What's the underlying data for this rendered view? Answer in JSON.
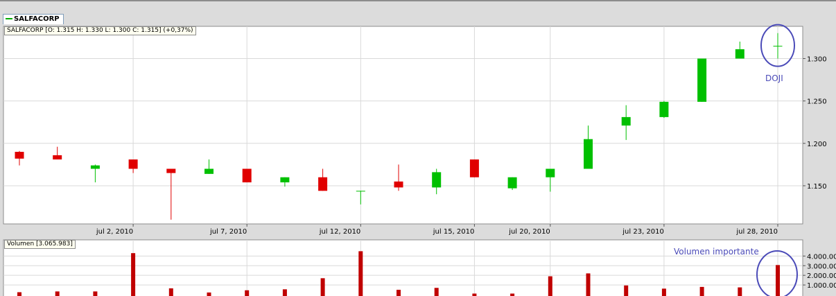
{
  "tab": {
    "label": "SALFACORP"
  },
  "price_info": "SALFACORP [O: 1.315  H: 1.330  L: 1.300  C: 1.315] (+0,37%)",
  "volume_info": "Volumen [3.065.983]",
  "annotations": {
    "doji": "DOJI",
    "volume": "Volumen importante"
  },
  "colors": {
    "up": "#00c000",
    "down": "#e00000",
    "volume": "#c00000",
    "annotation": "#4a4ab8",
    "grid": "#d9d9d9"
  },
  "chart_data": [
    {
      "type": "candlestick",
      "title": "",
      "x_tick_labels": [
        {
          "at": 3,
          "label": "jul 2, 2010"
        },
        {
          "at": 6,
          "label": "jul 7, 2010"
        },
        {
          "at": 9,
          "label": "jul 12, 2010"
        },
        {
          "at": 12,
          "label": "jul 15, 2010"
        },
        {
          "at": 14,
          "label": "jul 20, 2010"
        },
        {
          "at": 17,
          "label": "jul 23, 2010"
        },
        {
          "at": 20,
          "label": "jul 28, 2010"
        }
      ],
      "y_ticks": [
        1.15,
        1.2,
        1.25,
        1.3
      ],
      "y_tick_labels": [
        "1.150",
        "1.200",
        "1.250",
        "1.300"
      ],
      "ylim": [
        1.105,
        1.338
      ],
      "grid": true,
      "candles": [
        {
          "o": 1.19,
          "h": 1.191,
          "l": 1.174,
          "c": 1.182
        },
        {
          "o": 1.186,
          "h": 1.196,
          "l": 1.181,
          "c": 1.181
        },
        {
          "o": 1.17,
          "h": 1.175,
          "l": 1.154,
          "c": 1.174
        },
        {
          "o": 1.181,
          "h": 1.181,
          "l": 1.165,
          "c": 1.17
        },
        {
          "o": 1.17,
          "h": 1.17,
          "l": 1.11,
          "c": 1.165
        },
        {
          "o": 1.164,
          "h": 1.181,
          "l": 1.164,
          "c": 1.17
        },
        {
          "o": 1.17,
          "h": 1.17,
          "l": 1.154,
          "c": 1.154
        },
        {
          "o": 1.154,
          "h": 1.16,
          "l": 1.149,
          "c": 1.16
        },
        {
          "o": 1.16,
          "h": 1.17,
          "l": 1.144,
          "c": 1.144
        },
        {
          "o": 1.144,
          "h": 1.144,
          "l": 1.128,
          "c": 1.144
        },
        {
          "o": 1.155,
          "h": 1.175,
          "l": 1.144,
          "c": 1.148
        },
        {
          "o": 1.148,
          "h": 1.17,
          "l": 1.14,
          "c": 1.166
        },
        {
          "o": 1.181,
          "h": 1.181,
          "l": 1.16,
          "c": 1.16
        },
        {
          "o": 1.147,
          "h": 1.16,
          "l": 1.145,
          "c": 1.16
        },
        {
          "o": 1.16,
          "h": 1.17,
          "l": 1.143,
          "c": 1.17
        },
        {
          "o": 1.17,
          "h": 1.221,
          "l": 1.17,
          "c": 1.205
        },
        {
          "o": 1.221,
          "h": 1.245,
          "l": 1.204,
          "c": 1.231
        },
        {
          "o": 1.231,
          "h": 1.25,
          "l": 1.23,
          "c": 1.249
        },
        {
          "o": 1.249,
          "h": 1.3,
          "l": 1.249,
          "c": 1.3
        },
        {
          "o": 1.3,
          "h": 1.32,
          "l": 1.3,
          "c": 1.311
        },
        {
          "o": 1.315,
          "h": 1.33,
          "l": 1.3,
          "c": 1.315
        }
      ]
    },
    {
      "type": "bar",
      "title": "Volumen",
      "y_ticks": [
        1000000,
        2000000,
        3000000,
        4000000
      ],
      "y_tick_labels": [
        "1.000.000",
        "2.000.000",
        "3.000.000",
        "4.000.000"
      ],
      "ylim": [
        0,
        4600000
      ],
      "grid": true,
      "values": [
        250000,
        330000,
        330000,
        4300000,
        650000,
        220000,
        450000,
        550000,
        1700000,
        4500000,
        500000,
        700000,
        50000,
        50000,
        1900000,
        2200000,
        950000,
        620000,
        800000,
        750000,
        3065983
      ]
    }
  ]
}
